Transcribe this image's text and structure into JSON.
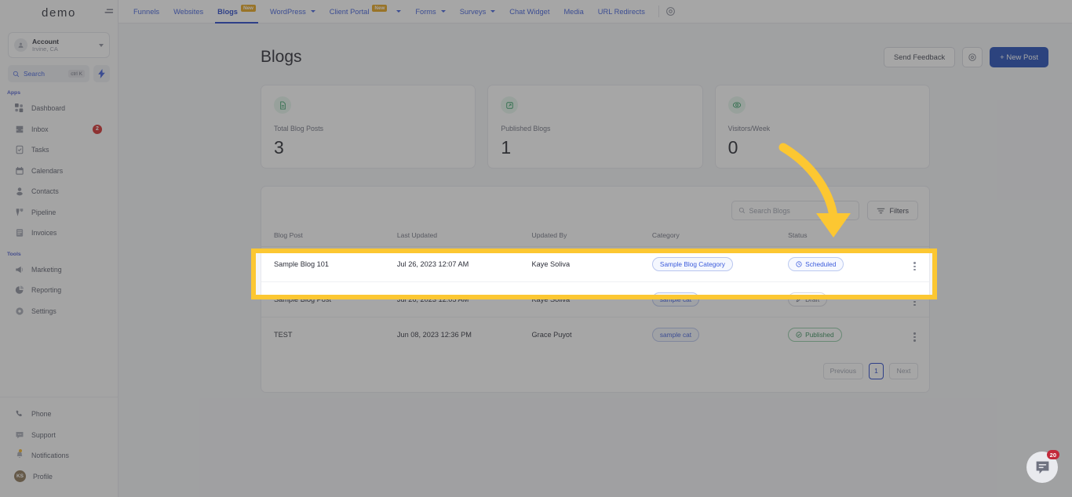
{
  "sidebar": {
    "logo": "demo",
    "account": {
      "name": "Account",
      "location": "Irvine, CA"
    },
    "search": {
      "label": "Search",
      "shortcut": "ctrl K"
    },
    "section_apps": "Apps",
    "section_tools": "Tools",
    "apps": [
      {
        "label": "Dashboard",
        "icon": "grid-icon",
        "badge": ""
      },
      {
        "label": "Inbox",
        "icon": "inbox-icon",
        "badge": "2"
      },
      {
        "label": "Tasks",
        "icon": "tasks-icon",
        "badge": ""
      },
      {
        "label": "Calendars",
        "icon": "calendar-icon",
        "badge": ""
      },
      {
        "label": "Contacts",
        "icon": "contacts-icon",
        "badge": ""
      },
      {
        "label": "Pipeline",
        "icon": "pipeline-icon",
        "badge": ""
      },
      {
        "label": "Invoices",
        "icon": "invoices-icon",
        "badge": ""
      }
    ],
    "tools": [
      {
        "label": "Marketing",
        "icon": "megaphone-icon"
      },
      {
        "label": "Reporting",
        "icon": "pie-chart-icon"
      },
      {
        "label": "Settings",
        "icon": "gear-icon"
      }
    ],
    "bottom": [
      {
        "label": "Phone",
        "icon": "phone-icon"
      },
      {
        "label": "Support",
        "icon": "chat-support-icon"
      },
      {
        "label": "Notifications",
        "icon": "bell-icon"
      },
      {
        "label": "Profile",
        "icon": "avatar-icon",
        "initials": "KS"
      }
    ]
  },
  "topnav": {
    "tabs": [
      {
        "label": "Funnels",
        "badge": "",
        "caret": false,
        "active": false
      },
      {
        "label": "Websites",
        "badge": "",
        "caret": false,
        "active": false
      },
      {
        "label": "Blogs",
        "badge": "New",
        "caret": false,
        "active": true
      },
      {
        "label": "WordPress",
        "badge": "",
        "caret": true,
        "active": false
      },
      {
        "label": "Client Portal",
        "badge": "New",
        "caret": true,
        "active": false
      },
      {
        "label": "Forms",
        "badge": "",
        "caret": true,
        "active": false
      },
      {
        "label": "Surveys",
        "badge": "",
        "caret": true,
        "active": false
      },
      {
        "label": "Chat Widget",
        "badge": "",
        "caret": false,
        "active": false
      },
      {
        "label": "Media",
        "badge": "",
        "caret": false,
        "active": false
      },
      {
        "label": "URL Redirects",
        "badge": "",
        "caret": false,
        "active": false
      }
    ],
    "settings_icon": "gear-icon",
    "menu_icon": "hamburger-icon"
  },
  "header": {
    "title": "Blogs",
    "send_feedback": "Send Feedback",
    "settings_icon": "gear-icon",
    "new_post": "+ New Post"
  },
  "stats": [
    {
      "label": "Total Blog Posts",
      "value": "3",
      "icon": "document-icon"
    },
    {
      "label": "Published Blogs",
      "value": "1",
      "icon": "published-icon"
    },
    {
      "label": "Visitors/Week",
      "value": "0",
      "icon": "eye-icon"
    }
  ],
  "table": {
    "search_placeholder": "Search Blogs",
    "filters_label": "Filters",
    "columns": [
      "Blog Post",
      "Last Updated",
      "Updated By",
      "Category",
      "Status"
    ],
    "rows": [
      {
        "blog_post": "Sample Blog 101",
        "last_updated": "Jul 26, 2023 12:07 AM",
        "updated_by": "Kaye Soliva",
        "category": "Sample Blog Category",
        "status": "Scheduled",
        "status_type": "scheduled",
        "status_icon": "clock-icon",
        "highlighted": true
      },
      {
        "blog_post": "Sample Blog Post",
        "last_updated": "Jul 26, 2023 12:05 AM",
        "updated_by": "Kaye Soliva",
        "category": "sample cat",
        "status": "Draft",
        "status_type": "draft",
        "status_icon": "pencil-icon",
        "highlighted": false
      },
      {
        "blog_post": "TEST",
        "last_updated": "Jun 08, 2023 12:36 PM",
        "updated_by": "Grace Puyot",
        "category": "sample cat",
        "status": "Published",
        "status_type": "published",
        "status_icon": "check-circle-icon",
        "highlighted": false
      }
    ],
    "pagination": {
      "previous": "Previous",
      "page": "1",
      "next": "Next"
    }
  },
  "chat_widget": {
    "badge": "20",
    "icon": "chat-bubble-icon"
  },
  "annotation": {
    "arrow_color": "#fcc732",
    "highlight_color": "#fcc732",
    "arrow_target": "Sample Blog 101 row"
  },
  "colors": {
    "primary": "#1e49b5",
    "link": "#3b5bdb",
    "accent_yellow": "#fcc732",
    "green": "#2f8a54",
    "red": "#c2293a"
  }
}
